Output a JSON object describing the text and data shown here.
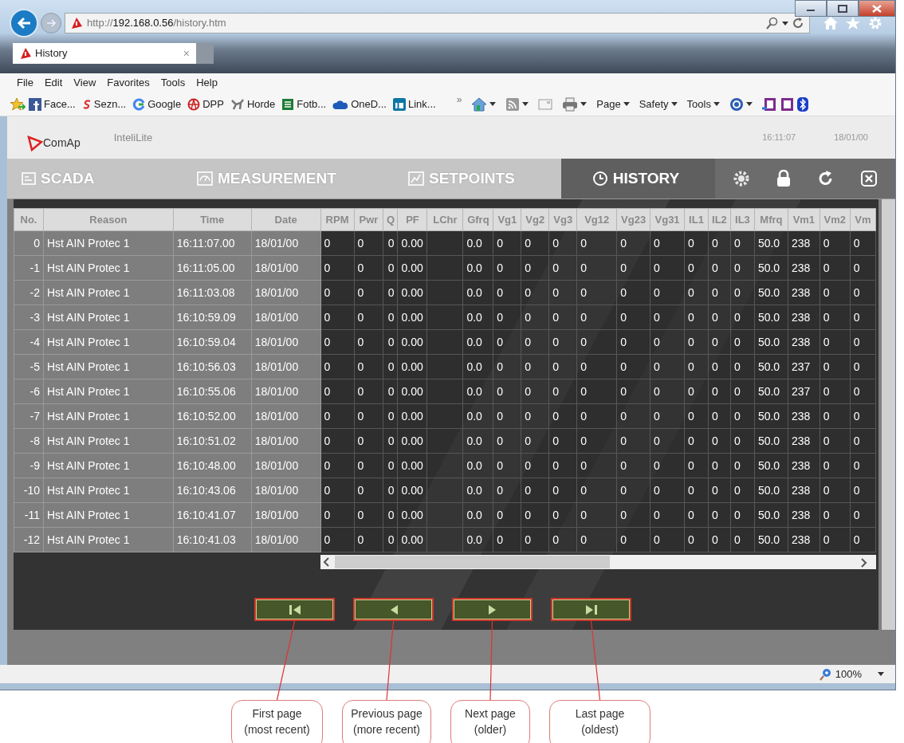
{
  "browser": {
    "address": {
      "prefix": "http://",
      "host": "192.168.0.56",
      "path": "/history.htm"
    },
    "tab": {
      "title": "History",
      "close": "×"
    },
    "menu": [
      "File",
      "Edit",
      "View",
      "Favorites",
      "Tools",
      "Help"
    ],
    "favorites": [
      "Face...",
      "Sezn...",
      "Google",
      "DPP",
      "Horde",
      "Fotb...",
      "OneD...",
      "Link..."
    ],
    "overflow": "»",
    "command_bar": [
      "Page",
      "Safety",
      "Tools"
    ],
    "status_bar": {
      "zoom": "100%"
    }
  },
  "app": {
    "brand": "ComAp",
    "product": "InteliLite",
    "time": "16:11:07",
    "date": "18/01/00",
    "nav": [
      {
        "label": "SCADA",
        "selected": false
      },
      {
        "label": "MEASUREMENT",
        "selected": false
      },
      {
        "label": "SETPOINTS",
        "selected": false
      },
      {
        "label": "HISTORY",
        "selected": true
      }
    ],
    "history": {
      "event_columns": [
        "No.",
        "Reason",
        "Time",
        "Date"
      ],
      "value_columns": [
        {
          "label": "RPM"
        },
        {
          "label": "Pwr"
        },
        {
          "label": "Q"
        },
        {
          "label": "PF"
        },
        {
          "label": "LChr",
          "blank": true
        },
        {
          "label": "Gfrq"
        },
        {
          "label": "Vg1"
        },
        {
          "label": "Vg2"
        },
        {
          "label": "Vg3"
        },
        {
          "label": "Vg12"
        },
        {
          "label": "Vg23"
        },
        {
          "label": "Vg31"
        },
        {
          "label": "IL1"
        },
        {
          "label": "IL2"
        },
        {
          "label": "IL3"
        },
        {
          "label": "Mfrq"
        },
        {
          "label": "Vm1"
        },
        {
          "label": "Vm2"
        },
        {
          "label": "Vm"
        }
      ],
      "rows": [
        {
          "no": "0",
          "reason": "Hst AIN Protec 1",
          "time": "16:11:07.00",
          "date": "18/01/00",
          "values": [
            "0",
            "0",
            "0",
            "0.00",
            "0.0",
            "0",
            "0",
            "0",
            "0",
            "0",
            "0",
            "0",
            "0",
            "0",
            "50.0",
            "238",
            "0",
            "0"
          ]
        },
        {
          "no": "-1",
          "reason": "Hst AIN Protec 1",
          "time": "16:11:05.00",
          "date": "18/01/00",
          "values": [
            "0",
            "0",
            "0",
            "0.00",
            "0.0",
            "0",
            "0",
            "0",
            "0",
            "0",
            "0",
            "0",
            "0",
            "0",
            "50.0",
            "238",
            "0",
            "0"
          ]
        },
        {
          "no": "-2",
          "reason": "Hst AIN Protec 1",
          "time": "16:11:03.08",
          "date": "18/01/00",
          "values": [
            "0",
            "0",
            "0",
            "0.00",
            "0.0",
            "0",
            "0",
            "0",
            "0",
            "0",
            "0",
            "0",
            "0",
            "0",
            "50.0",
            "238",
            "0",
            "0"
          ]
        },
        {
          "no": "-3",
          "reason": "Hst AIN Protec 1",
          "time": "16:10:59.09",
          "date": "18/01/00",
          "values": [
            "0",
            "0",
            "0",
            "0.00",
            "0.0",
            "0",
            "0",
            "0",
            "0",
            "0",
            "0",
            "0",
            "0",
            "0",
            "50.0",
            "238",
            "0",
            "0"
          ]
        },
        {
          "no": "-4",
          "reason": "Hst AIN Protec 1",
          "time": "16:10:59.04",
          "date": "18/01/00",
          "values": [
            "0",
            "0",
            "0",
            "0.00",
            "0.0",
            "0",
            "0",
            "0",
            "0",
            "0",
            "0",
            "0",
            "0",
            "0",
            "50.0",
            "238",
            "0",
            "0"
          ]
        },
        {
          "no": "-5",
          "reason": "Hst AIN Protec 1",
          "time": "16:10:56.03",
          "date": "18/01/00",
          "values": [
            "0",
            "0",
            "0",
            "0.00",
            "0.0",
            "0",
            "0",
            "0",
            "0",
            "0",
            "0",
            "0",
            "0",
            "0",
            "50.0",
            "237",
            "0",
            "0"
          ]
        },
        {
          "no": "-6",
          "reason": "Hst AIN Protec 1",
          "time": "16:10:55.06",
          "date": "18/01/00",
          "values": [
            "0",
            "0",
            "0",
            "0.00",
            "0.0",
            "0",
            "0",
            "0",
            "0",
            "0",
            "0",
            "0",
            "0",
            "0",
            "50.0",
            "237",
            "0",
            "0"
          ]
        },
        {
          "no": "-7",
          "reason": "Hst AIN Protec 1",
          "time": "16:10:52.00",
          "date": "18/01/00",
          "values": [
            "0",
            "0",
            "0",
            "0.00",
            "0.0",
            "0",
            "0",
            "0",
            "0",
            "0",
            "0",
            "0",
            "0",
            "0",
            "50.0",
            "238",
            "0",
            "0"
          ]
        },
        {
          "no": "-8",
          "reason": "Hst AIN Protec 1",
          "time": "16:10:51.02",
          "date": "18/01/00",
          "values": [
            "0",
            "0",
            "0",
            "0.00",
            "0.0",
            "0",
            "0",
            "0",
            "0",
            "0",
            "0",
            "0",
            "0",
            "0",
            "50.0",
            "238",
            "0",
            "0"
          ]
        },
        {
          "no": "-9",
          "reason": "Hst AIN Protec 1",
          "time": "16:10:48.00",
          "date": "18/01/00",
          "values": [
            "0",
            "0",
            "0",
            "0.00",
            "0.0",
            "0",
            "0",
            "0",
            "0",
            "0",
            "0",
            "0",
            "0",
            "0",
            "50.0",
            "238",
            "0",
            "0"
          ]
        },
        {
          "no": "-10",
          "reason": "Hst AIN Protec 1",
          "time": "16:10:43.06",
          "date": "18/01/00",
          "values": [
            "0",
            "0",
            "0",
            "0.00",
            "0.0",
            "0",
            "0",
            "0",
            "0",
            "0",
            "0",
            "0",
            "0",
            "0",
            "50.0",
            "238",
            "0",
            "0"
          ]
        },
        {
          "no": "-11",
          "reason": "Hst AIN Protec 1",
          "time": "16:10:41.07",
          "date": "18/01/00",
          "values": [
            "0",
            "0",
            "0",
            "0.00",
            "0.0",
            "0",
            "0",
            "0",
            "0",
            "0",
            "0",
            "0",
            "0",
            "0",
            "50.0",
            "238",
            "0",
            "0"
          ]
        },
        {
          "no": "-12",
          "reason": "Hst AIN Protec 1",
          "time": "16:10:41.03",
          "date": "18/01/00",
          "values": [
            "0",
            "0",
            "0",
            "0.00",
            "0.0",
            "0",
            "0",
            "0",
            "0",
            "0",
            "0",
            "0",
            "0",
            "0",
            "50.0",
            "238",
            "0",
            "0"
          ]
        }
      ]
    },
    "pager": [
      {
        "kind": "first"
      },
      {
        "kind": "previous"
      },
      {
        "kind": "next"
      },
      {
        "kind": "last"
      }
    ]
  },
  "callouts": [
    {
      "lines": [
        "First page",
        "(most recent)"
      ]
    },
    {
      "lines": [
        "Previous page",
        "(more recent)"
      ]
    },
    {
      "lines": [
        "Next page",
        "(older)"
      ]
    },
    {
      "lines": [
        "Last page",
        "(oldest)"
      ]
    }
  ]
}
